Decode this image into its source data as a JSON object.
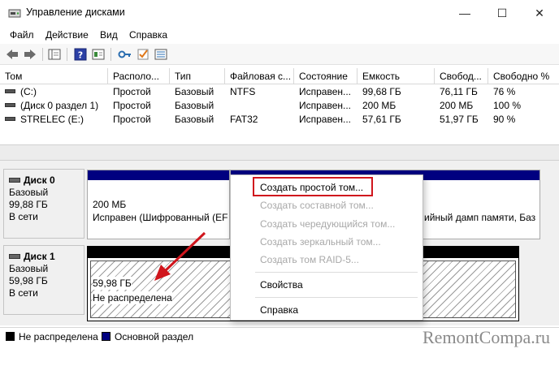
{
  "window": {
    "title": "Управление дисками",
    "controls": {
      "minimize": "—",
      "maximize": "☐",
      "close": "✕"
    }
  },
  "menu": [
    "Файл",
    "Действие",
    "Вид",
    "Справка"
  ],
  "toolbar_icons": [
    "back-arrow-icon",
    "forward-arrow-icon",
    "console-tree-icon",
    "help-icon",
    "properties-icon",
    "key-icon",
    "check-icon",
    "list-icon"
  ],
  "volume_list": {
    "columns": [
      "Том",
      "Располо...",
      "Тип",
      "Файловая с...",
      "Состояние",
      "Емкость",
      "Свобод...",
      "Свободно %"
    ],
    "rows": [
      [
        "(C:)",
        "Простой",
        "Базовый",
        "NTFS",
        "Исправен...",
        "99,68 ГБ",
        "76,11 ГБ",
        "76 %"
      ],
      [
        "(Диск 0 раздел 1)",
        "Простой",
        "Базовый",
        "",
        "Исправен...",
        "200 МБ",
        "200 МБ",
        "100 %"
      ],
      [
        "STRELEC (E:)",
        "Простой",
        "Базовый",
        "FAT32",
        "Исправен...",
        "57,61 ГБ",
        "51,97 ГБ",
        "90 %"
      ]
    ]
  },
  "disks": [
    {
      "name": "Диск 0",
      "type": "Базовый",
      "size": "99,88 ГБ",
      "status": "В сети",
      "partitions": [
        {
          "size": "200 МБ",
          "status": "Исправен (Шифрованный (EF"
        },
        {
          "size": "",
          "status": "ийный дамп памяти, Баз"
        }
      ]
    },
    {
      "name": "Диск 1",
      "type": "Базовый",
      "size": "59,98 ГБ",
      "status": "В сети",
      "partitions": [
        {
          "size": "59,98 ГБ",
          "status": "Не распределена"
        }
      ]
    }
  ],
  "legend": [
    {
      "label": "Не распределена",
      "color": "#000000"
    },
    {
      "label": "Основной раздел",
      "color": "#000080"
    }
  ],
  "context_menu": {
    "items": [
      {
        "label": "Создать простой том...",
        "enabled": true
      },
      {
        "label": "Создать составной том...",
        "enabled": false
      },
      {
        "label": "Создать чередующийся том...",
        "enabled": false
      },
      {
        "label": "Создать зеркальный том...",
        "enabled": false
      },
      {
        "label": "Создать том RAID-5...",
        "enabled": false
      },
      {
        "label": "Свойства",
        "enabled": true
      },
      {
        "label": "Справка",
        "enabled": true
      }
    ],
    "highlight_color": "#d0161d"
  },
  "colors": {
    "primary_partition": "#000080",
    "unallocated": "#000000",
    "annotation_red": "#d0161d"
  },
  "watermark": "RemontCompa.ru"
}
